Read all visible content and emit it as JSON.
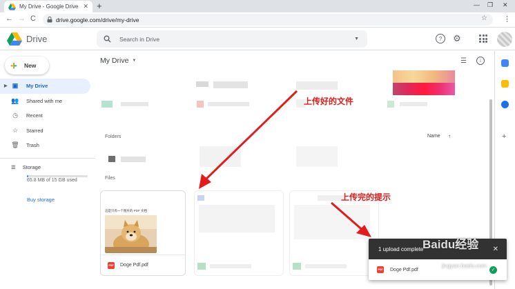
{
  "browser": {
    "tab_title": "My Drive - Google Drive",
    "tab_close": "✕",
    "new_tab": "+",
    "win_min": "—",
    "win_max": "❐",
    "win_close": "✕",
    "back": "←",
    "forward": "→",
    "reload": "C",
    "url": "drive.google.com/drive/my-drive",
    "star": "☆",
    "menu": "⋮"
  },
  "header": {
    "brand": "Drive",
    "search_placeholder": "Search in Drive",
    "help": "?",
    "settings": "⚙"
  },
  "sidebar": {
    "new_label": "New",
    "items": [
      {
        "label": "My Drive",
        "icon": "drive-icon"
      },
      {
        "label": "Shared with me",
        "icon": "people-icon"
      },
      {
        "label": "Recent",
        "icon": "clock-icon"
      },
      {
        "label": "Starred",
        "icon": "star-icon"
      },
      {
        "label": "Trash",
        "icon": "trash-icon"
      }
    ],
    "storage_label": "Storage",
    "storage_used": "65.8 MB of 15 GB used",
    "storage_fraction": 0.004,
    "buy_storage": "Buy storage"
  },
  "main": {
    "breadcrumb": "My Drive",
    "folders_label": "Folders",
    "sort_label": "Name",
    "sort_arrow": "↑",
    "files_label": "Files",
    "file_card": {
      "caption": "这是只有一个图片的 PDF 文档",
      "name": "Doge Pdf.pdf",
      "type": "PDF"
    }
  },
  "annotations": {
    "uploaded_file": "上传好的文件",
    "upload_hint": "上传完的提示"
  },
  "toast": {
    "title": "1 upload complete",
    "close": "✕",
    "file_name": "Doge Pdf.pdf",
    "status_icon": "check-icon"
  },
  "watermark": {
    "text": "Baidu经验",
    "sub": "jingyan.baidu.com"
  },
  "colors": {
    "accent": "#1a73e8",
    "active_bg": "#e8f0fe",
    "annotation": "#e31b1b",
    "toast_bg": "#323232",
    "success": "#0f9d58"
  }
}
